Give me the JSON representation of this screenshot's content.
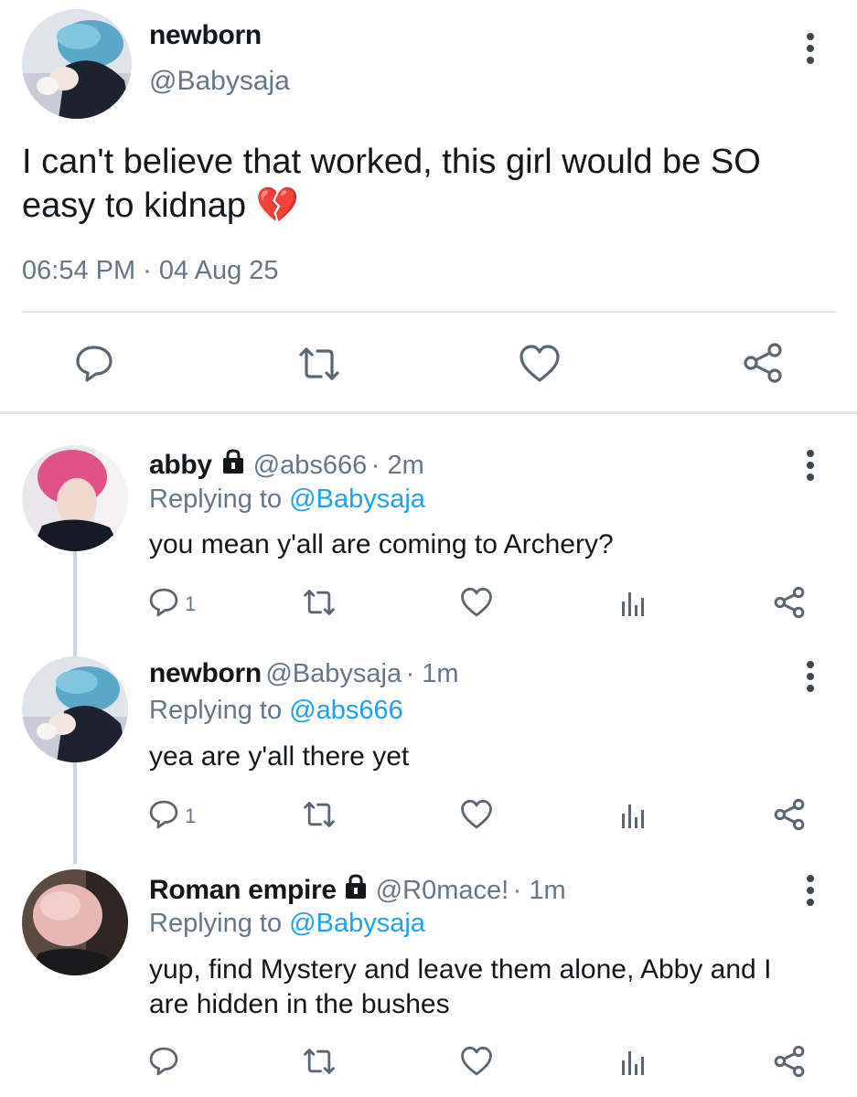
{
  "main_tweet": {
    "display_name": "newborn",
    "handle": "@Babysaja",
    "text": "I can't believe that worked, this girl would be SO easy to kidnap",
    "emoji": "💔",
    "timestamp": "06:54 PM · 04 Aug 25",
    "actions": [
      "reply-icon",
      "retweet-icon",
      "like-icon",
      "share-icon"
    ]
  },
  "replies": [
    {
      "display_name": "abby",
      "locked": true,
      "handle": "@abs666",
      "time": "· 2m",
      "replying_label": "Replying to",
      "replying_to": "@Babysaja",
      "text": "you mean y'all are coming to Archery?",
      "reply_count": "1"
    },
    {
      "display_name": "newborn",
      "locked": false,
      "handle": "@Babysaja",
      "time": "· 1m",
      "replying_label": "Replying to",
      "replying_to": "@abs666",
      "text": "yea are y'all there yet",
      "reply_count": "1"
    },
    {
      "display_name": "Roman empire",
      "locked": true,
      "handle": "@R0mace!",
      "time": "· 1m",
      "replying_label": "Replying to",
      "replying_to": "@Babysaja",
      "text_line1": "yup, find Mystery and leave them alone, Abby and I",
      "text_line2": "are hidden in the bushes",
      "reply_count": ""
    }
  ],
  "colors": {
    "link": "#1da1f2",
    "muted": "#657786",
    "icon": "#5b6670",
    "divider": "#e1e8ed"
  }
}
